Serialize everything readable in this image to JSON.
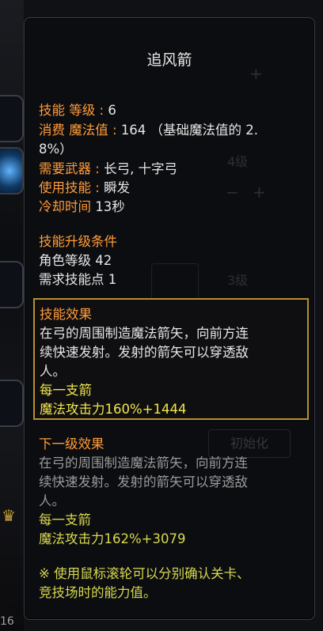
{
  "tooltip": {
    "title": "追风箭",
    "stats": {
      "skill_level_label": "技能 等级",
      "skill_level_value": "6",
      "mp_cost_label": "消费 魔法值",
      "mp_cost_value_line1": "164 （基础魔法值的 2.",
      "mp_cost_value_line2": "8%）",
      "weapon_label": "需要武器",
      "weapon_value": "长弓, 十字弓",
      "cast_label": "使用技能",
      "cast_value": "瞬发",
      "cooldown_label": "冷却时间",
      "cooldown_value": "13秒"
    },
    "upgrade": {
      "header": "技能升级条件",
      "char_level": "角色等级 42",
      "skill_points": "需求技能点 1"
    },
    "current_effect": {
      "header": "技能效果",
      "desc_line1": "在弓的周围制造魔法箭矢，向前方连",
      "desc_line2": "续快速发射。发射的箭矢可以穿透敌",
      "desc_line3": "人。",
      "per_arrow": "每一支箭",
      "damage": "魔法攻击力160%+1444"
    },
    "next_effect": {
      "header": "下一级效果",
      "desc_line1": "在弓的周围制造魔法箭矢，向前方连",
      "desc_line2": "续快速发射。发射的箭矢可以穿透敌",
      "desc_line3": "人。",
      "per_arrow": "每一支箭",
      "damage": "魔法攻击力162%+3079"
    },
    "note_line1": "※ 使用鼠标滚轮可以分别确认关卡、",
    "note_line2": "竞技场时的能力值。"
  },
  "background": {
    "level4": "4级",
    "level3": "3级",
    "reset_button": "初始化",
    "plus_top": "+",
    "minus_mid": "−",
    "plus_mid": "+",
    "bottom_number": "16"
  },
  "colors": {
    "label_orange": "#ff9b3a",
    "value_white": "#e6e6e6",
    "desc_gray": "#9a9a9a",
    "highlight_yellow": "#f2e64a",
    "border_gold": "#b88f2d"
  }
}
